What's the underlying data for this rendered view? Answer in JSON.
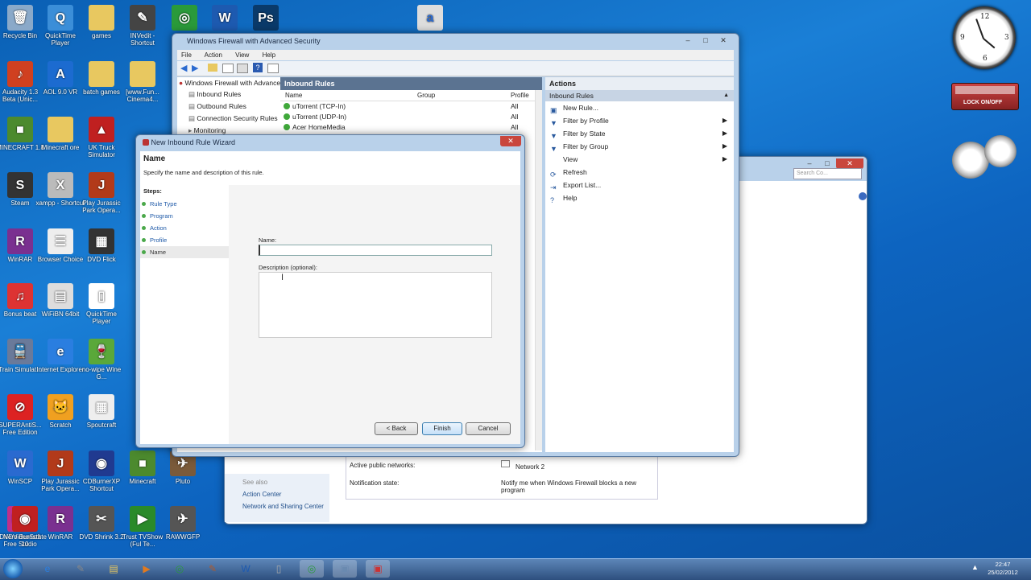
{
  "desktop_icons": [
    {
      "label": "Recycle Bin",
      "icon": "recycle-bin-icon",
      "color": "#8aa9c9",
      "glyph": "🗑"
    },
    {
      "label": "QuickTime Player",
      "icon": "quicktime-icon",
      "color": "#3b8ed8",
      "glyph": "Q"
    },
    {
      "label": "games",
      "icon": "folder-icon",
      "color": "#e8c860",
      "glyph": ""
    },
    {
      "label": "INVedit - Shortcut",
      "icon": "invedit-icon",
      "color": "#444",
      "glyph": "✎"
    },
    {
      "label": "Audacity 1.3 Beta (Unic...",
      "icon": "audacity-icon",
      "color": "#d04020",
      "glyph": "♪"
    },
    {
      "label": "AOL 9.0 VR",
      "icon": "aol-icon",
      "color": "#1c6bd0",
      "glyph": "A"
    },
    {
      "label": "batch games",
      "icon": "folder-icon",
      "color": "#e8c860",
      "glyph": ""
    },
    {
      "label": "[www.Fun... Cinema4...",
      "icon": "folder-icon",
      "color": "#e8c860",
      "glyph": ""
    },
    {
      "label": "MINECRAFT 1.8",
      "icon": "minecraft-icon",
      "color": "#4c8a2e",
      "glyph": "■"
    },
    {
      "label": "Minecraft ore",
      "icon": "folder-icon",
      "color": "#e8c860",
      "glyph": ""
    },
    {
      "label": "UK Truck Simulator",
      "icon": "truck-icon",
      "color": "#c02020",
      "glyph": "▲"
    },
    {
      "label": "Steam",
      "icon": "steam-icon",
      "color": "#333",
      "glyph": "S"
    },
    {
      "label": "xampp - Shortcut",
      "icon": "xampp-icon",
      "color": "#bbb",
      "glyph": "X"
    },
    {
      "label": "Play Jurassic Park Opera...",
      "icon": "jurassic-icon",
      "color": "#b23a1a",
      "glyph": "J"
    },
    {
      "label": "WinRAR",
      "icon": "winrar-icon",
      "color": "#7a3090",
      "glyph": "R"
    },
    {
      "label": "Browser Choice",
      "icon": "browser-choice-icon",
      "color": "#eee",
      "glyph": "☰"
    },
    {
      "label": "DVD Flick",
      "icon": "dvdflick-icon",
      "color": "#333",
      "glyph": "▦"
    },
    {
      "label": "Bonus beat",
      "icon": "bonus-icon",
      "color": "#d33",
      "glyph": "♫"
    },
    {
      "label": "WiFiBN 64bit",
      "icon": "wifi-icon",
      "color": "#ddd",
      "glyph": "▤"
    },
    {
      "label": "QuickTime Player",
      "icon": "quicktime-icon",
      "color": "#fff",
      "glyph": "▯"
    },
    {
      "label": "Train Simulat...",
      "icon": "train-icon",
      "color": "#6a7a9a",
      "glyph": "🚆"
    },
    {
      "label": "Internet Explorer",
      "icon": "ie-icon",
      "color": "#2a7ee0",
      "glyph": "e"
    },
    {
      "label": "no-wipe Wine G...",
      "icon": "wine-icon",
      "color": "#5aa83a",
      "glyph": "🍷"
    },
    {
      "label": "SUPERAntiS... Free Edition",
      "icon": "superantispyware-icon",
      "color": "#d22",
      "glyph": "⊘"
    },
    {
      "label": "Scratch",
      "icon": "scratch-icon",
      "color": "#f0a020",
      "glyph": "🐱"
    },
    {
      "label": "Spoutcraft",
      "icon": "spoutcraft-icon",
      "color": "#eee",
      "glyph": "▦"
    },
    {
      "label": "WinSCP",
      "icon": "winscp-icon",
      "color": "#2a6ad0",
      "glyph": "W"
    },
    {
      "label": "Play Jurassic Park Opera...",
      "icon": "jurassic-icon",
      "color": "#b23a1a",
      "glyph": "J"
    },
    {
      "label": "CDBurnerXP Shortcut",
      "icon": "cdburner-icon",
      "color": "#203a90",
      "glyph": "◉"
    },
    {
      "label": "Minecraft",
      "icon": "minecraft-icon",
      "color": "#4c8a2e",
      "glyph": "■"
    },
    {
      "label": "Pluto",
      "icon": "pluto-icon",
      "color": "#7a5a3a",
      "glyph": "✈"
    },
    {
      "label": "DVDVideoSoft Free Studio",
      "icon": "freestudio-icon",
      "color": "#c0308a",
      "glyph": "FS"
    },
    {
      "label": "WinRAR",
      "icon": "winrar-icon",
      "color": "#7a3090",
      "glyph": "R"
    },
    {
      "label": "DVD Shrink 3.2",
      "icon": "dvdshrink-icon",
      "color": "#555",
      "glyph": "✂"
    },
    {
      "label": "Trust TVShow (Ful Te...",
      "icon": "tvshow-icon",
      "color": "#2a8a2a",
      "glyph": "▶"
    },
    {
      "label": "RAWWGFP",
      "icon": "raw-icon",
      "color": "#555",
      "glyph": "✈"
    },
    {
      "label": "Nero Burnstate 10",
      "icon": "nero-icon",
      "color": "#c02020",
      "glyph": "◉"
    }
  ],
  "top_icons": [
    {
      "label": "chrome",
      "icon": "chrome-icon",
      "color": "#2a9a3a",
      "glyph": "◎"
    },
    {
      "label": "word",
      "icon": "word-icon",
      "color": "#1d5ab0",
      "glyph": "W"
    },
    {
      "label": "photoshop",
      "icon": "photoshop-icon",
      "color": "#0a3a6a",
      "glyph": "Ps"
    },
    {
      "label": "file",
      "icon": "file-icon",
      "color": "#ddd",
      "glyph": "a"
    }
  ],
  "firewall": {
    "title": "Windows Firewall with Advanced Security",
    "menu": [
      "File",
      "Action",
      "View",
      "Help"
    ],
    "tree": [
      "Windows Firewall with Advance",
      "Inbound Rules",
      "Outbound Rules",
      "Connection Security Rules",
      "Monitoring"
    ],
    "center_header": "Inbound Rules",
    "columns": [
      "Name",
      "Group",
      "Profile"
    ],
    "rules": [
      {
        "name": "uTorrent (TCP-In)",
        "profile": "All"
      },
      {
        "name": "uTorrent (UDP-In)",
        "profile": "All"
      },
      {
        "name": "Acer HomeMedia",
        "profile": "All"
      }
    ],
    "actions_header": "Actions",
    "actions_section": "Inbound Rules",
    "actions": [
      {
        "label": "New Rule...",
        "icon": "new-rule-icon",
        "glyph": "▣",
        "sub": false
      },
      {
        "label": "Filter by Profile",
        "icon": "filter-icon",
        "glyph": "▼",
        "sub": true
      },
      {
        "label": "Filter by State",
        "icon": "filter-icon",
        "glyph": "▼",
        "sub": true
      },
      {
        "label": "Filter by Group",
        "icon": "filter-icon",
        "glyph": "▼",
        "sub": true
      },
      {
        "label": "View",
        "icon": "view-icon",
        "glyph": "",
        "sub": true
      },
      {
        "label": "Refresh",
        "icon": "refresh-icon",
        "glyph": "⟳",
        "sub": false
      },
      {
        "label": "Export List...",
        "icon": "export-icon",
        "glyph": "⇥",
        "sub": false
      },
      {
        "label": "Help",
        "icon": "help-icon",
        "glyph": "?",
        "sub": false
      }
    ]
  },
  "control_panel": {
    "search_placeholder": "Search Co...",
    "see_also": "See also",
    "links": [
      "Action Center",
      "Network and Sharing Center"
    ],
    "active_networks_label": "Active public networks:",
    "active_networks_value": "Network 2",
    "notification_label": "Notification state:",
    "notification_value": "Notify me when Windows Firewall blocks a new program"
  },
  "wizard": {
    "title": "New Inbound Rule Wizard",
    "heading": "Name",
    "subheading": "Specify the name and description of this rule.",
    "steps_label": "Steps:",
    "steps": [
      "Rule Type",
      "Program",
      "Action",
      "Profile",
      "Name"
    ],
    "name_label": "Name:",
    "name_value": "",
    "description_label": "Description (optional):",
    "description_value": "",
    "back_label": "< Back",
    "finish_label": "Finish",
    "cancel_label": "Cancel"
  },
  "gadgets": {
    "clock_numbers": [
      "12",
      "3",
      "6",
      "9"
    ],
    "lock_label": "LOCK ON/OFF"
  },
  "taskbar": {
    "time": "22:47",
    "date": "25/02/2012"
  }
}
